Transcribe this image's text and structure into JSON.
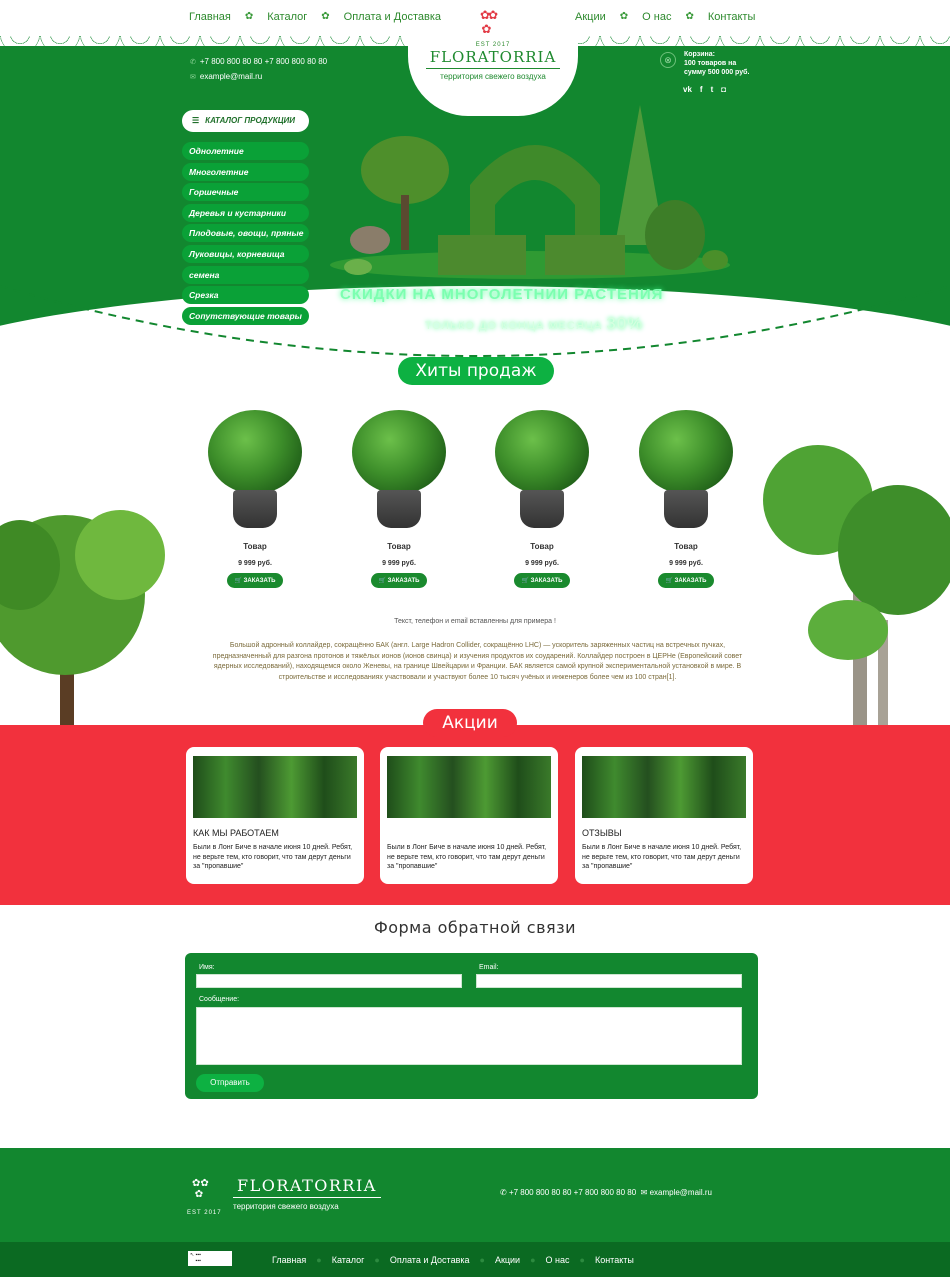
{
  "nav": {
    "left": [
      "Главная",
      "Каталог",
      "Оплата и Доставка"
    ],
    "right": [
      "Акции",
      "О нас",
      "Контакты"
    ]
  },
  "logo": {
    "est": "EST 2017",
    "brand": "FLORATORRIA",
    "tagline": "территория свежего воздуха"
  },
  "contacts": {
    "phones": "+7 800 800 80 80  +7 800 800 80 80",
    "email": "example@mail.ru"
  },
  "cart": {
    "label": "Корзина:",
    "line1": "100 товаров на",
    "line2": "сумму 500 000 руб."
  },
  "social": [
    "vk",
    "f",
    "t",
    "ig"
  ],
  "catalog": {
    "heading": "КАТАЛОГ ПРОДУКЦИИ",
    "items": [
      "Однолетние",
      "Многолетние",
      "Горшечные",
      "Деревья и кустарники",
      "Плодовые, овощи, пряные",
      "Луковицы, корневища",
      "семена",
      "Срезка",
      "Сопутствующие товары"
    ]
  },
  "promo": {
    "line1": "СКИДКИ НА МНОГОЛЕТНИИ РАСТЕНИЯ",
    "line2": "ТОЛЬКО ДО КОНЦА МЕСЯЦА",
    "percent": "30%"
  },
  "hits": {
    "title": "Хиты продаж",
    "products": [
      {
        "name": "Товар",
        "price": "9 999 руб.",
        "button": "ЗАКАЗАТЬ"
      },
      {
        "name": "Товар",
        "price": "9 999 руб.",
        "button": "ЗАКАЗАТЬ"
      },
      {
        "name": "Товар",
        "price": "9 999 руб.",
        "button": "ЗАКАЗАТЬ"
      },
      {
        "name": "Товар",
        "price": "9 999 руб.",
        "button": "ЗАКАЗАТЬ"
      }
    ]
  },
  "note": "Текст, телефон и email вставленны для примера !",
  "description": "Большой адронный коллайдер, сокращённо БАК (англ. Large Hadron Collider, сокращённо LHC) — ускоритель заряженных частиц на встречных пучках, предназначенный для разгона протонов и тяжёлых ионов (ионов свинца) и изучения продуктов их соударений. Коллайдер построен в ЦЕРНе (Европейский совет ядерных исследований), находящемся около Женевы, на границе Швейцарии и Франции. БАК является самой крупной экспериментальной установкой в мире. В строительстве и исследованиях участвовали и участвуют более 10 тысяч учёных и инженеров более чем из 100 стран[1].",
  "akcii": {
    "title": "Акции",
    "cards": [
      {
        "title": "КАК МЫ РАБОТАЕМ",
        "text": "Были в Лонг Биче в начале июня 10 дней. Ребят, не верьте тем, кто говорит, что там дерут деньги за \"пропавшие\""
      },
      {
        "title": "",
        "text": "Были в Лонг Биче в начале июня 10 дней. Ребят, не верьте тем, кто говорит, что там дерут деньги за \"пропавшие\""
      },
      {
        "title": "ОТЗЫВЫ",
        "text": "Были в Лонг Биче в начале июня 10 дней. Ребят, не верьте тем, кто говорит, что там дерут деньги за \"пропавшие\""
      }
    ]
  },
  "form": {
    "title": "Форма обратной связи",
    "name_label": "Имя:",
    "email_label": "Email:",
    "message_label": "Сообщение:",
    "submit": "Отправить"
  },
  "footer": {
    "brand": "FLORATORRIA",
    "tagline": "территория свежего воздуха",
    "est": "EST 2017",
    "phones": "+7 800 800 80 80   +7 800 800 80 80",
    "email": "example@mail.ru",
    "links": [
      "Главная",
      "Каталог",
      "Оплата и Доставка",
      "Акции",
      "О нас",
      "Контакты"
    ]
  },
  "colors": {
    "primary_green": "#12872f",
    "accent_red": "#f2313d",
    "menu_green": "#0aa137",
    "pill_green": "#0db142"
  }
}
